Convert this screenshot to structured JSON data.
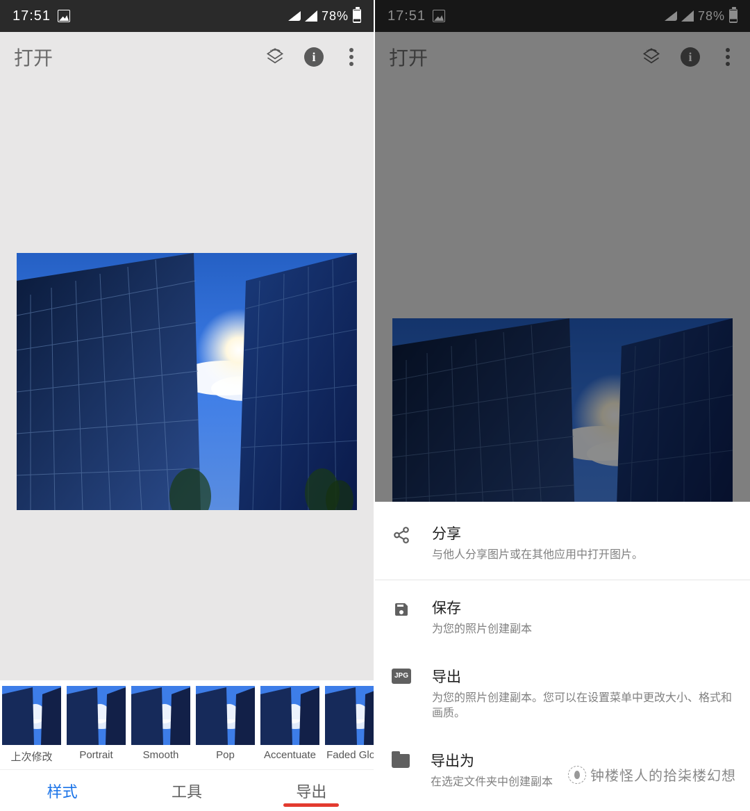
{
  "status": {
    "time": "17:51",
    "battery": "78%"
  },
  "toolbar": {
    "title": "打开"
  },
  "styles": {
    "items": [
      {
        "label": "上次修改"
      },
      {
        "label": "Portrait"
      },
      {
        "label": "Smooth"
      },
      {
        "label": "Pop"
      },
      {
        "label": "Accentuate"
      },
      {
        "label": "Faded Glow"
      }
    ]
  },
  "tabs": {
    "styles": "样式",
    "tools": "工具",
    "export": "导出"
  },
  "sheet": {
    "share": {
      "title": "分享",
      "desc": "与他人分享图片或在其他应用中打开图片。"
    },
    "save": {
      "title": "保存",
      "desc": "为您的照片创建副本"
    },
    "export": {
      "title": "导出",
      "desc": "为您的照片创建副本。您可以在设置菜单中更改大小、格式和画质。"
    },
    "exportAs": {
      "title": "导出为",
      "desc": "在选定文件夹中创建副本"
    },
    "jpg_badge": "JPG"
  },
  "watermark": "钟楼怪人的拾柒楼幻想"
}
